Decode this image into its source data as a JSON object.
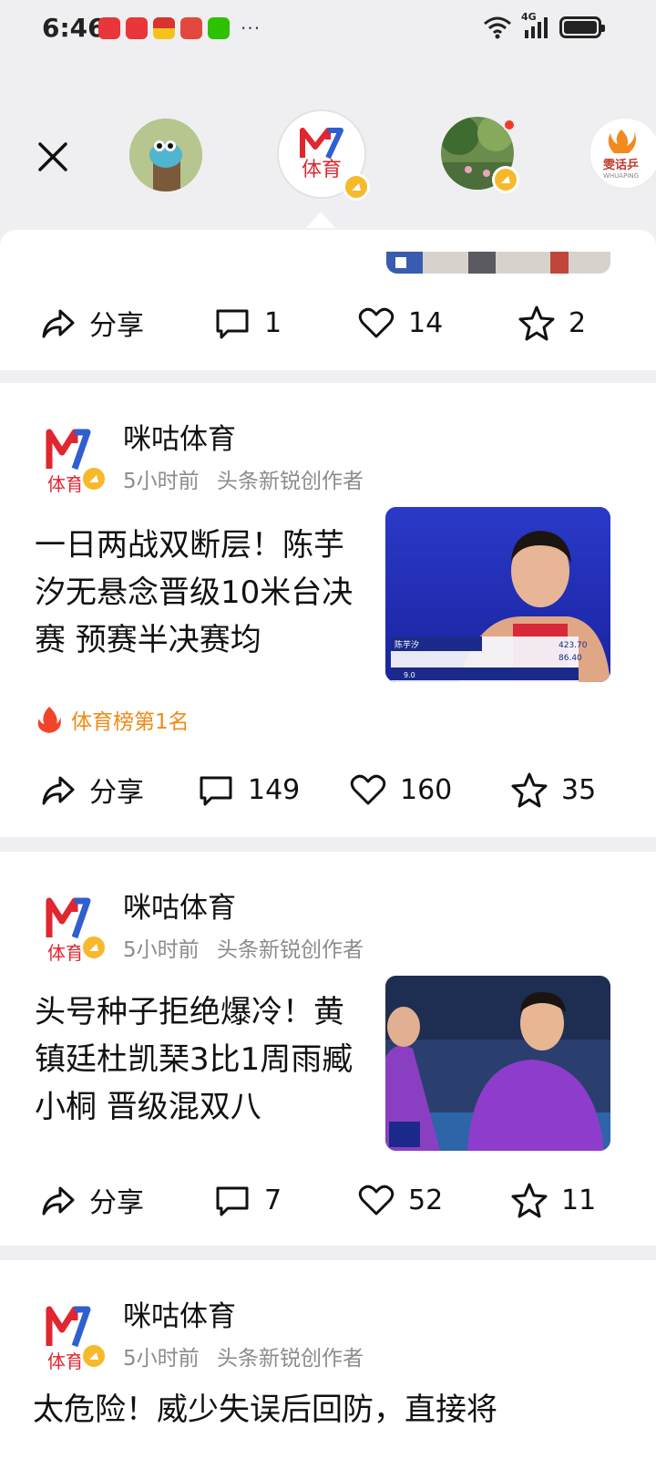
{
  "status_bar": {
    "time": "6:46",
    "more": "···",
    "signal_label": "4G",
    "notification_apps": [
      {
        "name": "huawei-app-icon",
        "color": "#e8363a"
      },
      {
        "name": "huawei-app-icon",
        "color": "#e8363a"
      },
      {
        "name": "news-app-icon",
        "color": "#d8332c"
      },
      {
        "name": "reader-app-icon",
        "color": "#e2483e"
      },
      {
        "name": "wechat-app-icon",
        "color": "#2dc100"
      }
    ]
  },
  "switcher": {
    "avatars": [
      {
        "name": "avatar-cartoon",
        "selected": false
      },
      {
        "name": "avatar-migu-sports",
        "selected": true,
        "text": "体育"
      },
      {
        "name": "avatar-nature",
        "selected": false,
        "has_new": true
      },
      {
        "name": "avatar-partial",
        "selected": false,
        "text": "雯话乒",
        "subtext": "WHUAPING"
      }
    ]
  },
  "posts": [
    {
      "actions": {
        "share": "分享",
        "comments": "1",
        "likes": "14",
        "favorites": "2"
      }
    },
    {
      "author": "咪咕体育",
      "time": "5小时前",
      "badge": "头条新锐创作者",
      "headline": "一日两战双断层！陈芋汐无悬念晋级10米台决赛 预赛半决赛均",
      "rank": "体育榜第1名",
      "thumb_scoreboard": {
        "name": "陈芋汐",
        "score1": "423.70",
        "score2": "86.40",
        "score_val": "9.0"
      },
      "actions": {
        "share": "分享",
        "comments": "149",
        "likes": "160",
        "favorites": "35"
      }
    },
    {
      "author": "咪咕体育",
      "time": "5小时前",
      "badge": "头条新锐创作者",
      "headline": "头号种子拒绝爆冷！黄镇廷杜凯琹3比1周雨臧小桐 晋级混双八",
      "actions": {
        "share": "分享",
        "comments": "7",
        "likes": "52",
        "favorites": "11"
      }
    },
    {
      "author": "咪咕体育",
      "time": "5小时前",
      "badge": "头条新锐创作者",
      "headline": "太危险！威少失误后回防，直接将"
    }
  ],
  "brand": {
    "migu_text": "体育",
    "accent": "#f08a16",
    "badge_yellow": "#f7b92b",
    "migu_red": "#e0262f",
    "migu_blue": "#2f5fd0"
  }
}
